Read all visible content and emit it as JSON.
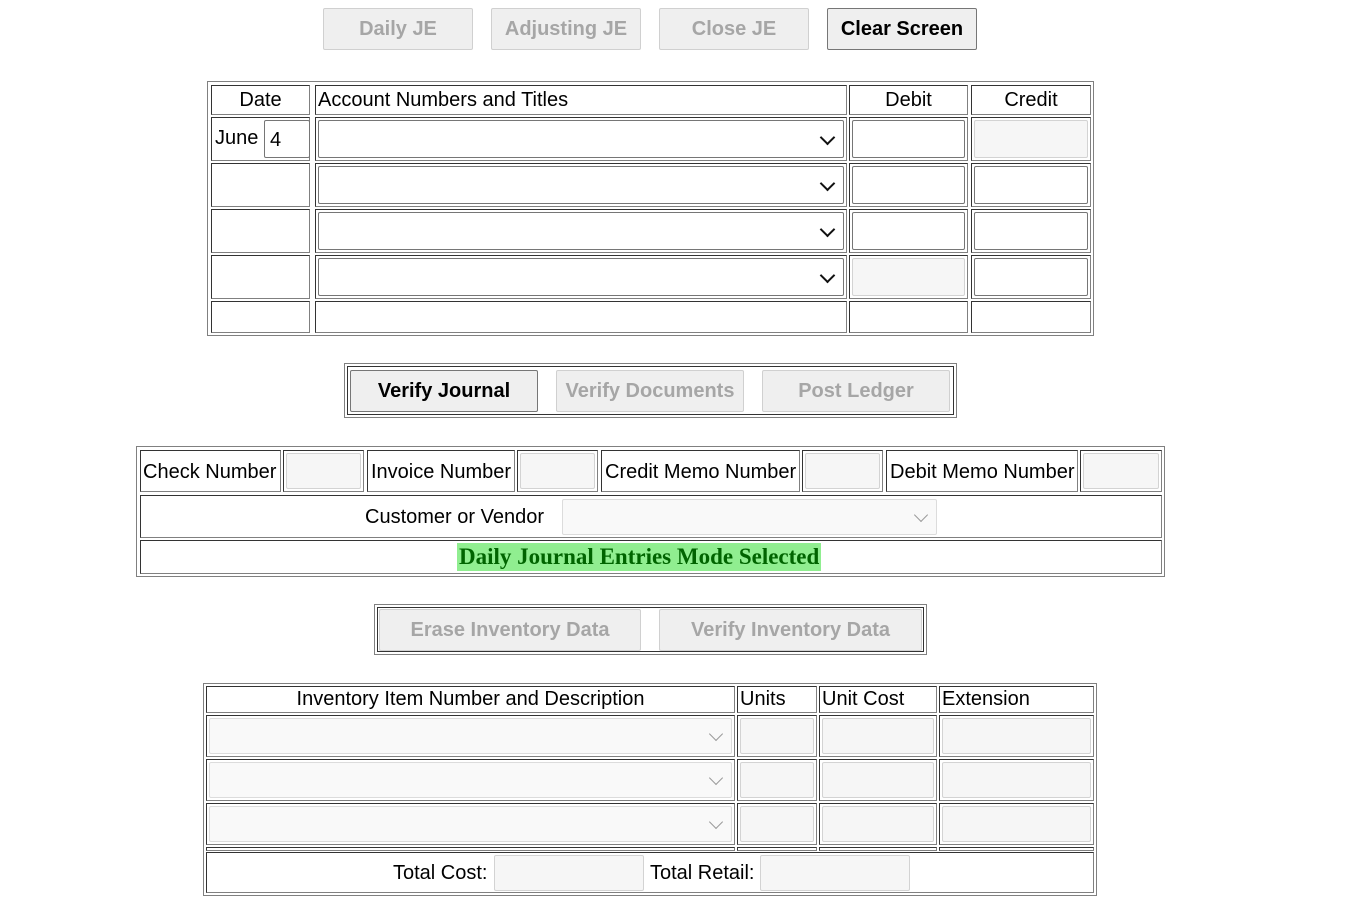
{
  "toolbar": {
    "daily_je": "Daily JE",
    "adjusting_je": "Adjusting JE",
    "close_je": "Close JE",
    "clear_screen": "Clear Screen"
  },
  "journal": {
    "headers": {
      "date": "Date",
      "account": "Account Numbers and Titles",
      "debit": "Debit",
      "credit": "Credit"
    },
    "month": "June",
    "day": "4",
    "rows": [
      {
        "account": "",
        "debit": "",
        "credit": "",
        "debit_disabled": false,
        "credit_disabled": true
      },
      {
        "account": "",
        "debit": "",
        "credit": "",
        "debit_disabled": false,
        "credit_disabled": false
      },
      {
        "account": "",
        "debit": "",
        "credit": "",
        "debit_disabled": false,
        "credit_disabled": false
      },
      {
        "account": "",
        "debit": "",
        "credit": "",
        "debit_disabled": true,
        "credit_disabled": false
      }
    ]
  },
  "actions": {
    "verify_journal": "Verify Journal",
    "verify_documents": "Verify Documents",
    "post_ledger": "Post Ledger"
  },
  "documents": {
    "check_number_label": "Check Number",
    "check_number": "",
    "invoice_number_label": "Invoice Number",
    "invoice_number": "",
    "credit_memo_label": "Credit Memo Number",
    "credit_memo": "",
    "debit_memo_label": "Debit Memo Number",
    "debit_memo": "",
    "customer_vendor_label": "Customer or Vendor",
    "customer_vendor": "",
    "status_message": "Daily Journal Entries Mode Selected",
    "status_color": "#006400",
    "status_bg": "#90ee90"
  },
  "inventory_actions": {
    "erase": "Erase Inventory Data",
    "verify": "Verify Inventory Data"
  },
  "inventory": {
    "headers": {
      "item": "Inventory Item Number and Description",
      "units": "Units",
      "unit_cost": "Unit Cost",
      "extension": "Extension"
    },
    "rows": [
      {
        "item": "",
        "units": "",
        "unit_cost": "",
        "extension": ""
      },
      {
        "item": "",
        "units": "",
        "unit_cost": "",
        "extension": ""
      },
      {
        "item": "",
        "units": "",
        "unit_cost": "",
        "extension": ""
      }
    ],
    "total_cost_label": "Total Cost:",
    "total_cost": "",
    "total_retail_label": "Total Retail:",
    "total_retail": ""
  }
}
